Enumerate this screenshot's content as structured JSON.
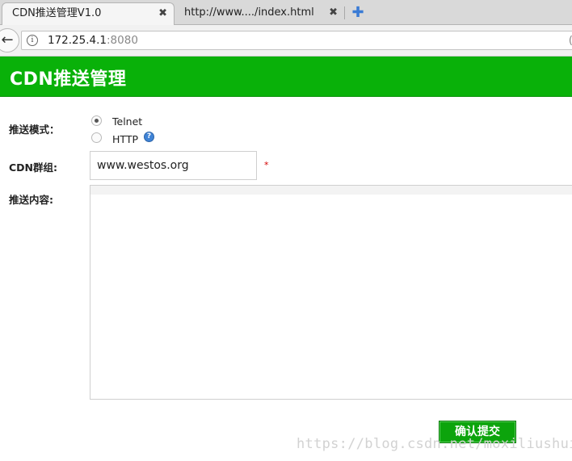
{
  "browser": {
    "tabs": [
      {
        "title": "CDN推送管理V1.0",
        "close": "✖"
      },
      {
        "title": "http://www..../index.html",
        "close": "✖"
      }
    ],
    "new_tab": "✚",
    "back": "←",
    "url": {
      "host": "172.25.4.1",
      "port": ":8080",
      "right_mark": "("
    }
  },
  "header": {
    "title": "CDN推送管理",
    "color": "#09b109"
  },
  "form": {
    "mode_label": "推送模式：",
    "mode_options": [
      "Telnet",
      "HTTP"
    ],
    "mode_selected": "Telnet",
    "help_icon": "?",
    "group_label": "CDN群组:",
    "group_value": "www.westos.org",
    "required_mark": "*",
    "content_label": "推送内容:",
    "content_value": "",
    "submit_label": "确认提交"
  },
  "watermark": "https://blog.csdn.net/moxiliushui"
}
